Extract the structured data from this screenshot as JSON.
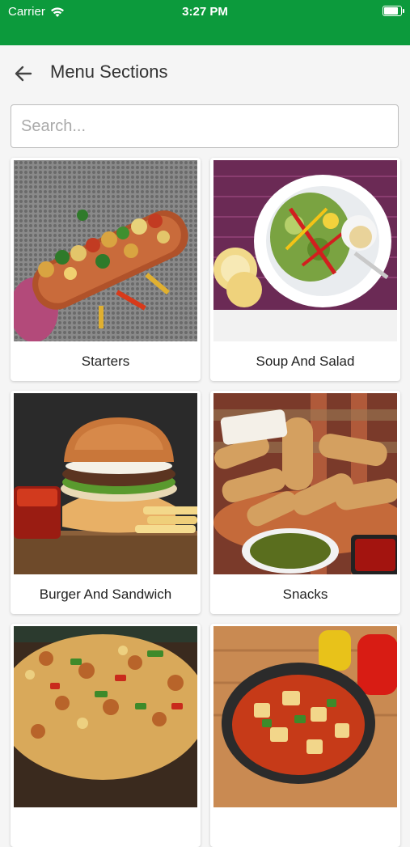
{
  "status_bar": {
    "carrier": "Carrier",
    "time": "3:27 PM",
    "battery_level": 0.9
  },
  "header": {
    "title": "Menu Sections",
    "back_icon": "arrow-left-icon"
  },
  "search": {
    "placeholder": "Search...",
    "value": ""
  },
  "sections": [
    {
      "label": "Starters"
    },
    {
      "label": "Soup And Salad"
    },
    {
      "label": "Burger And Sandwich"
    },
    {
      "label": "Snacks"
    },
    {
      "label": ""
    },
    {
      "label": ""
    }
  ],
  "colors": {
    "status_bar": "#0c9a3c",
    "background": "#f5f5f5"
  }
}
